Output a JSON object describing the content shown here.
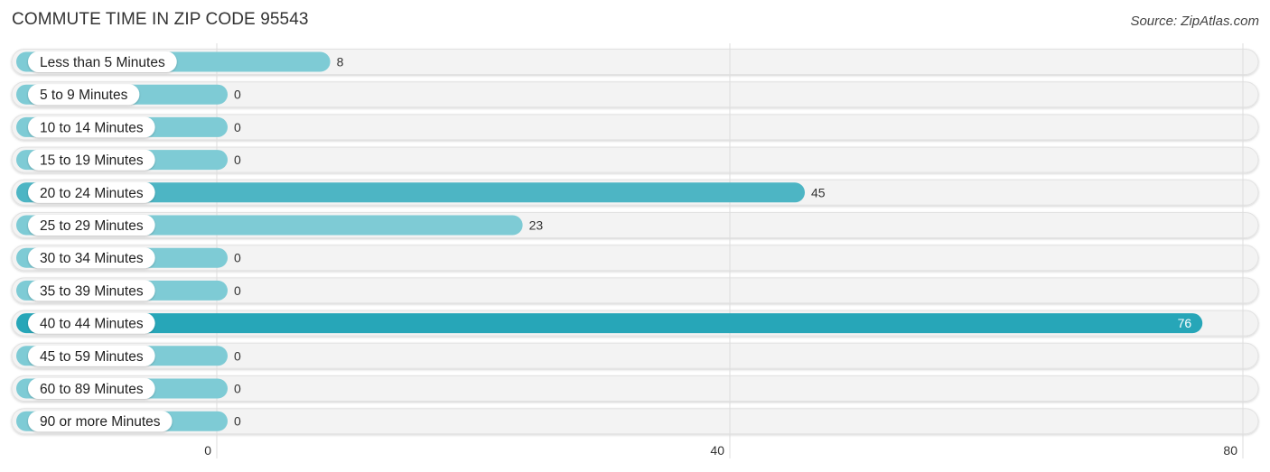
{
  "header": {
    "title": "COMMUTE TIME IN ZIP CODE 95543",
    "source": "Source: ZipAtlas.com"
  },
  "colors": {
    "bar_light": "#7ecbd5",
    "bar_medium": "#4db5c4",
    "bar_dark": "#27a6b8",
    "track": "#f3f3f3",
    "grid": "#dddddd"
  },
  "chart_data": {
    "type": "bar",
    "orientation": "horizontal",
    "title": "COMMUTE TIME IN ZIP CODE 95543",
    "xlabel": "",
    "ylabel": "",
    "xlim": [
      0,
      80
    ],
    "xticks": [
      0,
      40,
      80
    ],
    "grid": true,
    "categories": [
      "Less than 5 Minutes",
      "5 to 9 Minutes",
      "10 to 14 Minutes",
      "15 to 19 Minutes",
      "20 to 24 Minutes",
      "25 to 29 Minutes",
      "30 to 34 Minutes",
      "35 to 39 Minutes",
      "40 to 44 Minutes",
      "45 to 59 Minutes",
      "60 to 89 Minutes",
      "90 or more Minutes"
    ],
    "values": [
      8,
      0,
      0,
      0,
      45,
      23,
      0,
      0,
      76,
      0,
      0,
      0
    ]
  }
}
